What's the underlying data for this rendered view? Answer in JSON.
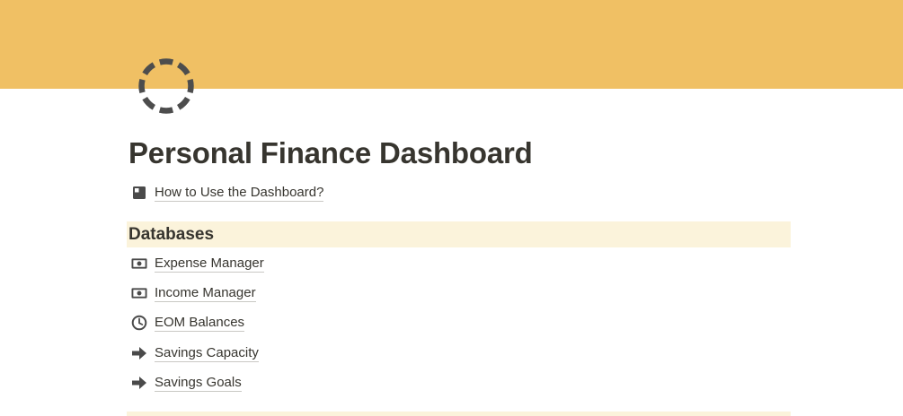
{
  "cover": {
    "color": "#f0c064"
  },
  "page": {
    "icon": "loading-circle-icon",
    "title": "Personal Finance Dashboard"
  },
  "help_link": {
    "icon": "square-icon",
    "label": "How to Use the Dashboard?"
  },
  "databases": {
    "heading": "Databases",
    "background": "#fbf3db",
    "items": [
      {
        "icon": "money-bill-icon",
        "label": "Expense Manager"
      },
      {
        "icon": "money-bill-icon",
        "label": "Income Manager"
      },
      {
        "icon": "clock-icon",
        "label": "EOM Balances"
      },
      {
        "icon": "arrow-right-icon",
        "label": "Savings Capacity"
      },
      {
        "icon": "arrow-right-icon",
        "label": "Savings Goals"
      }
    ]
  }
}
